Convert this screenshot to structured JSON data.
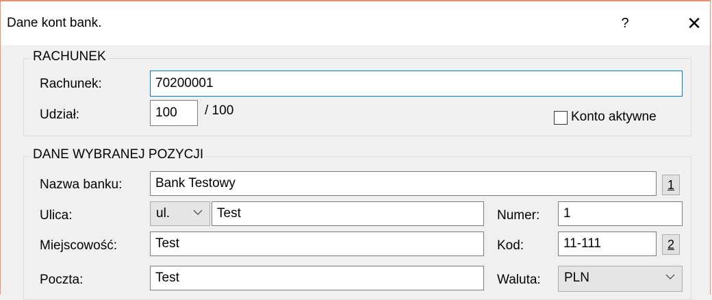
{
  "window": {
    "title": "Dane kont bank.",
    "help_label": "?",
    "close_label": "✕"
  },
  "rachunek_group": {
    "legend": "RACHUNEK",
    "rachunek_label": "Rachunek:",
    "rachunek_value": "70200001",
    "udzial_label": "Udział:",
    "udzial_value": "100",
    "udzial_suffix": "/ 100",
    "konto_aktywne_label": "Konto aktywne",
    "konto_aktywne_checked": false
  },
  "position_group": {
    "legend": "DANE WYBRANEJ POZYCJI",
    "nazwa_label": "Nazwa banku:",
    "nazwa_value": "Bank Testowy",
    "nazwa_btn": "1",
    "ulica_label": "Ulica:",
    "ulica_prefix": "ul.",
    "ulica_value": "Test",
    "numer_label": "Numer:",
    "numer_value": "1",
    "miejscowosc_label": "Miejscowość:",
    "miejscowosc_value": "Test",
    "kod_label": "Kod:",
    "kod_value": "11-111",
    "kod_btn": "2",
    "poczta_label": "Poczta:",
    "poczta_value": "Test",
    "waluta_label": "Waluta:",
    "waluta_value": "PLN"
  },
  "icons": {
    "dropdown": "chevron-down-icon"
  }
}
